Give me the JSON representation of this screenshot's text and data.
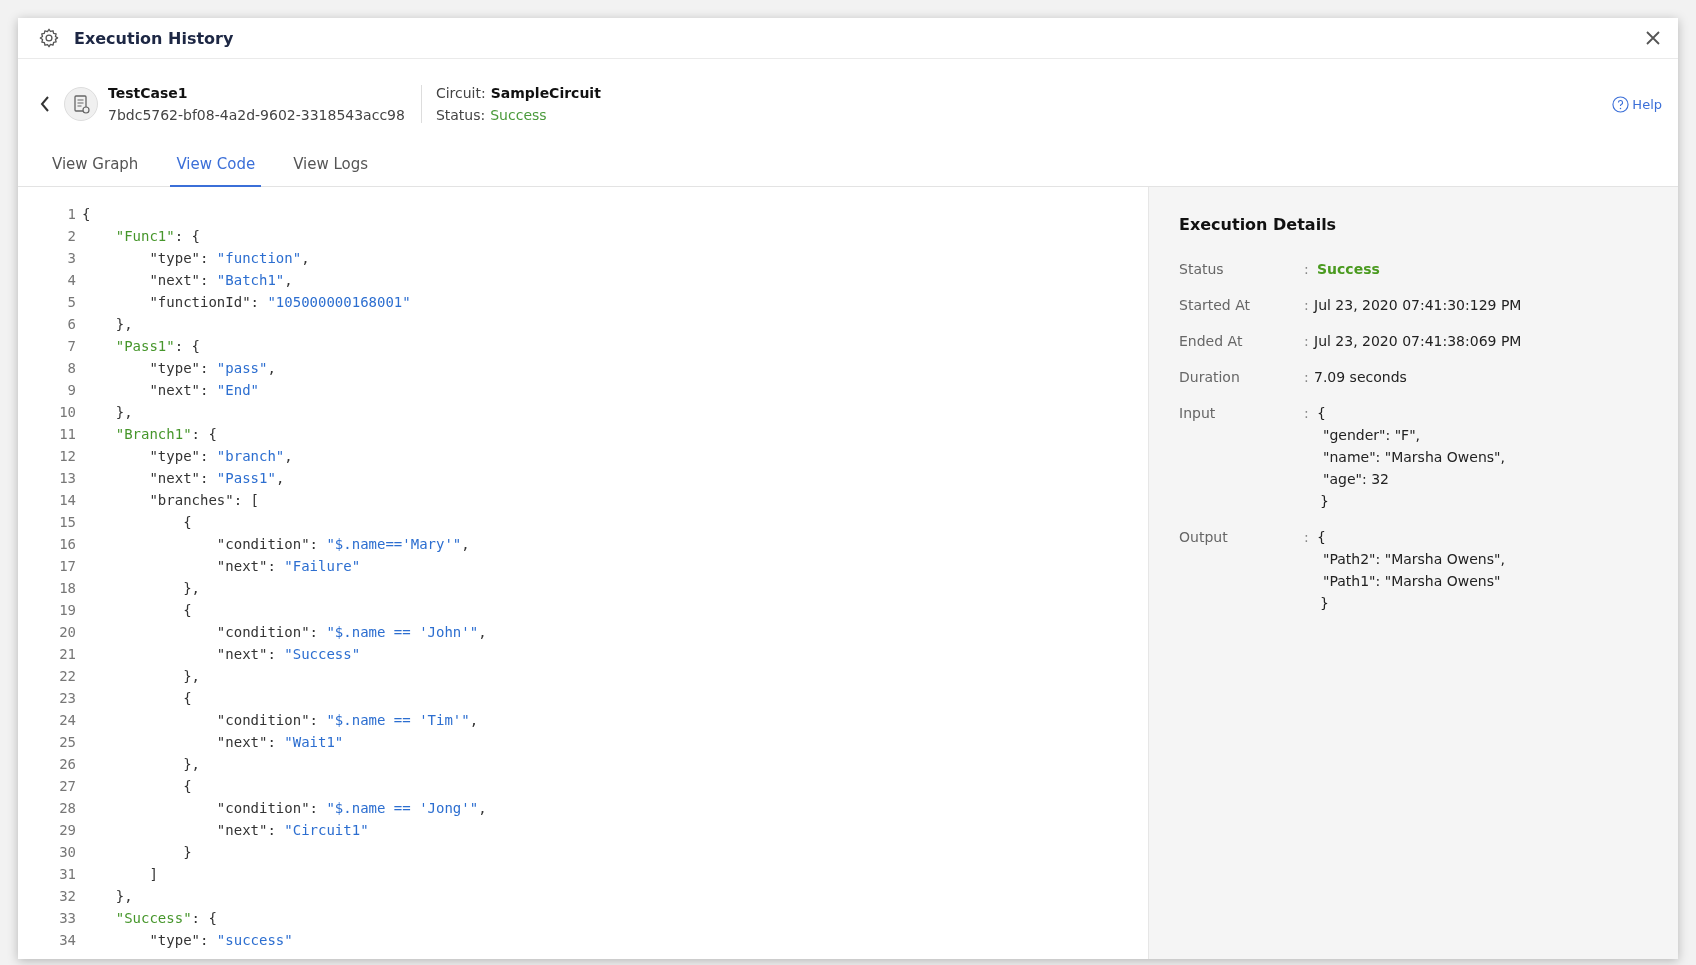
{
  "window": {
    "title": "Execution History"
  },
  "header": {
    "name": "TestCase1",
    "id": "7bdc5762-bf08-4a2d-9602-3318543acc98",
    "circuit_label": "Circuit:",
    "circuit": "SampleCircuit",
    "status_label": "Status:",
    "status": "Success",
    "help": "Help"
  },
  "tabs": [
    {
      "label": "View Graph",
      "selected": false
    },
    {
      "label": "View Code",
      "selected": true
    },
    {
      "label": "View Logs",
      "selected": false
    }
  ],
  "code": [
    {
      "number": "1",
      "tokens": [
        {
          "kind": "plain",
          "text": "{"
        }
      ]
    },
    {
      "number": "2",
      "tokens": [
        {
          "kind": "name",
          "text": "    \"Func1\""
        },
        {
          "kind": "plain",
          "text": ": {"
        }
      ]
    },
    {
      "number": "3",
      "tokens": [
        {
          "kind": "plain",
          "text": "        \"type\": "
        },
        {
          "kind": "value",
          "text": "\"function\""
        },
        {
          "kind": "plain",
          "text": ","
        }
      ]
    },
    {
      "number": "4",
      "tokens": [
        {
          "kind": "plain",
          "text": "        \"next\": "
        },
        {
          "kind": "value",
          "text": "\"Batch1\""
        },
        {
          "kind": "plain",
          "text": ","
        }
      ]
    },
    {
      "number": "5",
      "tokens": [
        {
          "kind": "plain",
          "text": "        \"functionId\": "
        },
        {
          "kind": "value",
          "text": "\"105000000168001\""
        }
      ]
    },
    {
      "number": "6",
      "tokens": [
        {
          "kind": "plain",
          "text": "    },"
        }
      ]
    },
    {
      "number": "7",
      "tokens": [
        {
          "kind": "name",
          "text": "    \"Pass1\""
        },
        {
          "kind": "plain",
          "text": ": {"
        }
      ]
    },
    {
      "number": "8",
      "tokens": [
        {
          "kind": "plain",
          "text": "        \"type\": "
        },
        {
          "kind": "value",
          "text": "\"pass\""
        },
        {
          "kind": "plain",
          "text": ","
        }
      ]
    },
    {
      "number": "9",
      "tokens": [
        {
          "kind": "plain",
          "text": "        \"next\": "
        },
        {
          "kind": "value",
          "text": "\"End\""
        }
      ]
    },
    {
      "number": "10",
      "tokens": [
        {
          "kind": "plain",
          "text": "    },"
        }
      ]
    },
    {
      "number": "11",
      "tokens": [
        {
          "kind": "name",
          "text": "    \"Branch1\""
        },
        {
          "kind": "plain",
          "text": ": {"
        }
      ]
    },
    {
      "number": "12",
      "tokens": [
        {
          "kind": "plain",
          "text": "        \"type\": "
        },
        {
          "kind": "value",
          "text": "\"branch\""
        },
        {
          "kind": "plain",
          "text": ","
        }
      ]
    },
    {
      "number": "13",
      "tokens": [
        {
          "kind": "plain",
          "text": "        \"next\": "
        },
        {
          "kind": "value",
          "text": "\"Pass1\""
        },
        {
          "kind": "plain",
          "text": ","
        }
      ]
    },
    {
      "number": "14",
      "tokens": [
        {
          "kind": "plain",
          "text": "        \"branches\": ["
        }
      ]
    },
    {
      "number": "15",
      "tokens": [
        {
          "kind": "plain",
          "text": "            {"
        }
      ]
    },
    {
      "number": "16",
      "tokens": [
        {
          "kind": "plain",
          "text": "                \"condition\": "
        },
        {
          "kind": "value",
          "text": "\"$.name=='Mary'\""
        },
        {
          "kind": "plain",
          "text": ","
        }
      ]
    },
    {
      "number": "17",
      "tokens": [
        {
          "kind": "plain",
          "text": "                \"next\": "
        },
        {
          "kind": "value",
          "text": "\"Failure\""
        }
      ]
    },
    {
      "number": "18",
      "tokens": [
        {
          "kind": "plain",
          "text": "            },"
        }
      ]
    },
    {
      "number": "19",
      "tokens": [
        {
          "kind": "plain",
          "text": "            {"
        }
      ]
    },
    {
      "number": "20",
      "tokens": [
        {
          "kind": "plain",
          "text": "                \"condition\": "
        },
        {
          "kind": "value",
          "text": "\"$.name == 'John'\""
        },
        {
          "kind": "plain",
          "text": ","
        }
      ]
    },
    {
      "number": "21",
      "tokens": [
        {
          "kind": "plain",
          "text": "                \"next\": "
        },
        {
          "kind": "value",
          "text": "\"Success\""
        }
      ]
    },
    {
      "number": "22",
      "tokens": [
        {
          "kind": "plain",
          "text": "            },"
        }
      ]
    },
    {
      "number": "23",
      "tokens": [
        {
          "kind": "plain",
          "text": "            {"
        }
      ]
    },
    {
      "number": "24",
      "tokens": [
        {
          "kind": "plain",
          "text": "                \"condition\": "
        },
        {
          "kind": "value",
          "text": "\"$.name == 'Tim'\""
        },
        {
          "kind": "plain",
          "text": ","
        }
      ]
    },
    {
      "number": "25",
      "tokens": [
        {
          "kind": "plain",
          "text": "                \"next\": "
        },
        {
          "kind": "value",
          "text": "\"Wait1\""
        }
      ]
    },
    {
      "number": "26",
      "tokens": [
        {
          "kind": "plain",
          "text": "            },"
        }
      ]
    },
    {
      "number": "27",
      "tokens": [
        {
          "kind": "plain",
          "text": "            {"
        }
      ]
    },
    {
      "number": "28",
      "tokens": [
        {
          "kind": "plain",
          "text": "                \"condition\": "
        },
        {
          "kind": "value",
          "text": "\"$.name == 'Jong'\""
        },
        {
          "kind": "plain",
          "text": ","
        }
      ]
    },
    {
      "number": "29",
      "tokens": [
        {
          "kind": "plain",
          "text": "                \"next\": "
        },
        {
          "kind": "value",
          "text": "\"Circuit1\""
        }
      ]
    },
    {
      "number": "30",
      "tokens": [
        {
          "kind": "plain",
          "text": "            }"
        }
      ]
    },
    {
      "number": "31",
      "tokens": [
        {
          "kind": "plain",
          "text": "        ]"
        }
      ]
    },
    {
      "number": "32",
      "tokens": [
        {
          "kind": "plain",
          "text": "    },"
        }
      ]
    },
    {
      "number": "33",
      "tokens": [
        {
          "kind": "name",
          "text": "    \"Success\""
        },
        {
          "kind": "plain",
          "text": ": {"
        }
      ]
    },
    {
      "number": "34",
      "tokens": [
        {
          "kind": "plain",
          "text": "        \"type\": "
        },
        {
          "kind": "value",
          "text": "\"success\""
        }
      ]
    }
  ],
  "details": {
    "title": "Execution Details",
    "rows": [
      {
        "label": "Status",
        "separator": ":",
        "kind": "status",
        "lines": [
          "Success"
        ]
      },
      {
        "label": "Started At",
        "separator": ":",
        "kind": "text",
        "lines": [
          "Jul 23, 2020 07:41:30:129 PM"
        ]
      },
      {
        "label": "Ended At",
        "separator": ":",
        "kind": "text",
        "lines": [
          "Jul 23, 2020 07:41:38:069 PM"
        ]
      },
      {
        "label": "Duration",
        "separator": ":",
        "kind": "text",
        "lines": [
          "7.09 seconds"
        ]
      },
      {
        "label": "Input",
        "separator": ":",
        "kind": "json",
        "lines": [
          "{",
          "\"gender\": \"F\",",
          "\"name\": \"Marsha Owens\",",
          "\"age\": 32",
          "}"
        ]
      },
      {
        "label": "Output",
        "separator": ":",
        "kind": "json",
        "lines": [
          "{",
          "\"Path2\": \"Marsha Owens\",",
          "\"Path1\": \"Marsha Owens\"",
          "}"
        ]
      }
    ]
  }
}
